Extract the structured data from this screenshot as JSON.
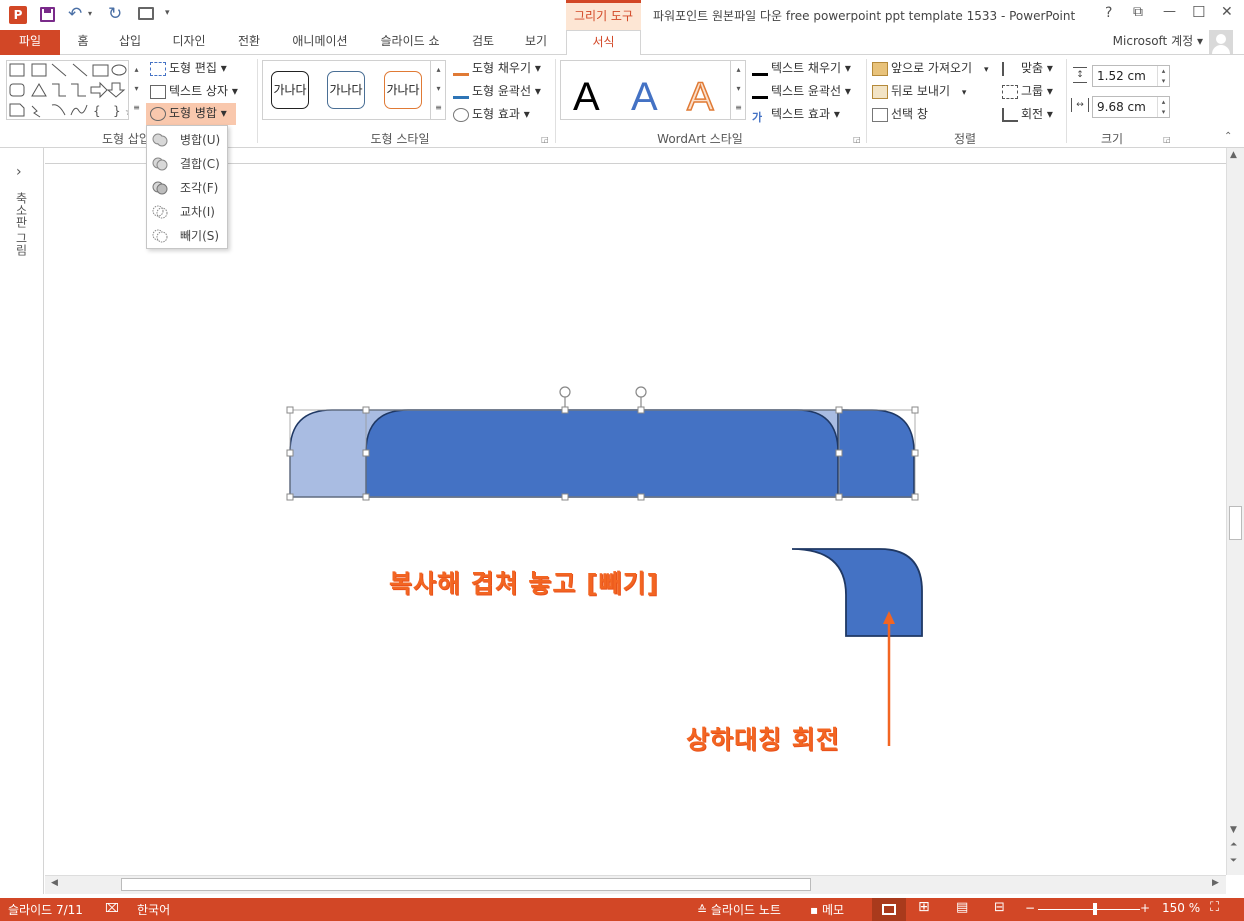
{
  "titlebar": {
    "app_icon": "P",
    "qat": [
      "save-icon",
      "undo-icon",
      "redo-icon",
      "present-icon"
    ],
    "context_group": "그리기 도구",
    "title": "파워포인트 원본파일 다운 free powerpoint ppt template 1533 - PowerPoint",
    "help": "?",
    "restore": "⧉",
    "minimize": "—",
    "maximize": "☐",
    "close": "✕"
  },
  "tabs": {
    "file": "파일",
    "items": [
      "홈",
      "삽입",
      "디자인",
      "전환",
      "애니메이션",
      "슬라이드 쇼",
      "검토",
      "보기"
    ],
    "active": "서식",
    "account": "Microsoft 계정 ▾"
  },
  "ribbon": {
    "insert_shapes": {
      "label": "도형 삽입",
      "edit_shape": "도형 편집 ▾",
      "text_box": "텍스트 상자 ▾",
      "merge_shapes": "도형 병합 ▾"
    },
    "shape_styles": {
      "label": "도형 스타일",
      "samples": [
        "가나다",
        "가나다",
        "가나다"
      ],
      "fill": "도형 채우기 ▾",
      "outline": "도형 윤곽선 ▾",
      "effects": "도형 효과 ▾"
    },
    "wordart": {
      "label": "WordArt 스타일",
      "samples": [
        "A",
        "A",
        "A"
      ],
      "text_fill": "텍스트 채우기 ▾",
      "text_outline": "텍스트 윤곽선 ▾",
      "text_effects": "텍스트 효과 ▾"
    },
    "arrange": {
      "label": "정렬",
      "bring_forward": "앞으로 가져오기",
      "send_backward": "뒤로 보내기",
      "selection_pane": "선택 창",
      "align": "맞춤 ▾",
      "group": "그룹 ▾",
      "rotate": "회전 ▾"
    },
    "size": {
      "label": "크기",
      "height": "1.52 cm",
      "width": "9.68 cm"
    }
  },
  "merge_menu": {
    "items": [
      "병합(U)",
      "결합(C)",
      "조각(F)",
      "교차(I)",
      "빼기(S)"
    ]
  },
  "left_pane": {
    "label": "축소판 그림",
    "expand": "›"
  },
  "slide": {
    "annotation1": "복사해 겹쳐 놓고 [빼기]",
    "annotation2": "상하대칭 회전"
  },
  "statusbar": {
    "slide_info": "슬라이드 7/11",
    "language": "한국어",
    "notes": "슬라이드 노트",
    "comments": "메모",
    "zoom": "150 %"
  },
  "colors": {
    "accent": "#d24726",
    "shape_fill": "#4472c4",
    "shape_light": "#a9bce2",
    "shape_outline": "#1f3864",
    "annotation": "#f26522",
    "context_tab": "#fde6d4"
  }
}
